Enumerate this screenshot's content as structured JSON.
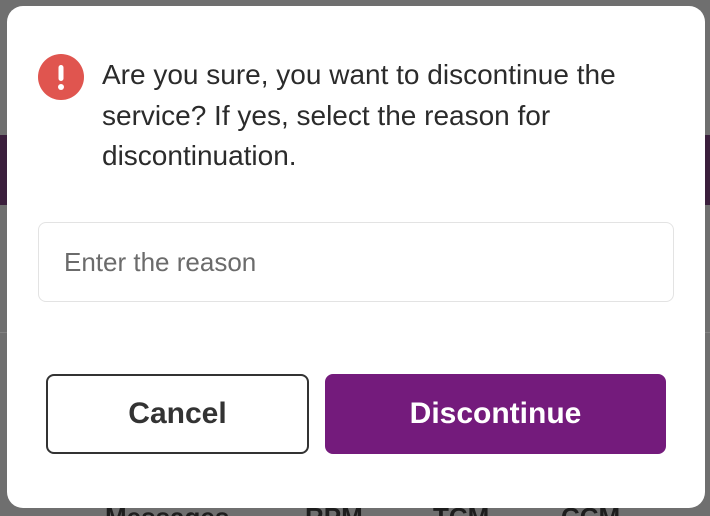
{
  "dialog": {
    "message": "Are you sure, you want to discontinue the service? If yes, select the reason for discontinuation.",
    "icon": "alert-icon",
    "reason_input": {
      "value": "",
      "placeholder": "Enter the reason"
    },
    "cancel_label": "Cancel",
    "discontinue_label": "Discontinue"
  },
  "background": {
    "tabs": [
      "Messages",
      "RPM",
      "TCM",
      "CCM"
    ]
  },
  "colors": {
    "accent": "#741b7c",
    "alert": "#e0554f",
    "overlay": "#6f6f6f",
    "text": "#2b2b2b"
  }
}
